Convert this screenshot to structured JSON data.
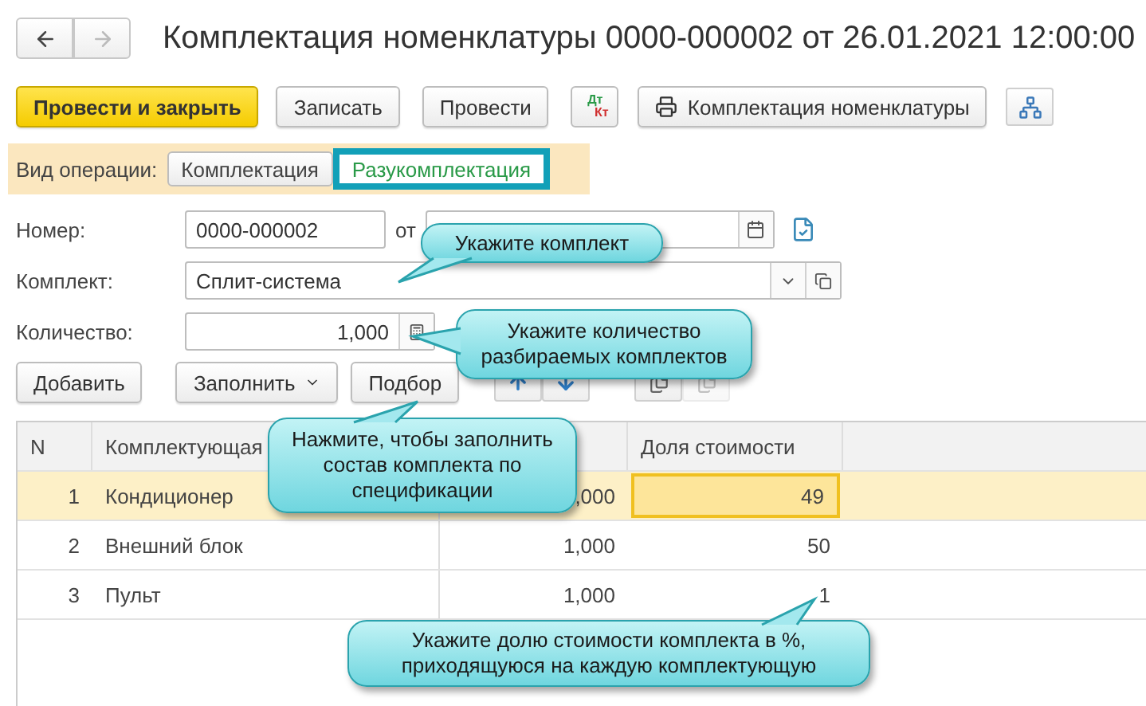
{
  "title": "Комплектация номенклатуры 0000-000002 от 26.01.2021 12:00:00",
  "toolbar": [
    {
      "kind": "primary",
      "label": "Провести и закрыть"
    },
    {
      "kind": "plain",
      "label": "Записать"
    },
    {
      "kind": "plain",
      "label": "Провести"
    },
    {
      "kind": "dtkt",
      "dt": "Дт",
      "kt": "Кт"
    },
    {
      "kind": "print",
      "label": "Комплектация номенклатуры"
    },
    {
      "kind": "structure"
    }
  ],
  "operation": {
    "label": "Вид операции:",
    "options": [
      {
        "label": "Комплектация",
        "selected": false
      },
      {
        "label": "Разукомплектация",
        "selected": true
      }
    ]
  },
  "number": {
    "label": "Номер:",
    "value": "0000-000002",
    "date_label": "от"
  },
  "kit": {
    "label": "Комплект:",
    "value": "Сплит-система"
  },
  "quantity": {
    "label": "Количество:",
    "value": "1,000"
  },
  "table_buttons": [
    {
      "kind": "text",
      "label": "Добавить"
    },
    {
      "kind": "dropdown",
      "label": "Заполнить"
    },
    {
      "kind": "text",
      "label": "Подбор"
    },
    {
      "kind": "up"
    },
    {
      "kind": "down"
    },
    {
      "kind": "copy",
      "disabled": false
    },
    {
      "kind": "copy",
      "disabled": true
    }
  ],
  "columns": {
    "n": "N",
    "item": "Комплектующая",
    "share": "Доля стоимости"
  },
  "rows": [
    {
      "n": "1",
      "item": "Кондиционер",
      "quantity": ",000",
      "share": "49",
      "selected": true
    },
    {
      "n": "2",
      "item": "Внешний блок",
      "quantity": "1,000",
      "share": "50",
      "selected": false
    },
    {
      "n": "3",
      "item": "Пульт",
      "quantity": "1,000",
      "share": "1",
      "selected": false
    }
  ],
  "callouts": [
    {
      "text": "Укажите комплект"
    },
    {
      "text": "Укажите количество разбираемых комплектов"
    },
    {
      "text": "Нажмите, чтобы заполнить состав комплекта по спецификации"
    },
    {
      "text": "Укажите долю стоимости комплекта в %, приходящуюся на каждую комплектующую"
    }
  ]
}
